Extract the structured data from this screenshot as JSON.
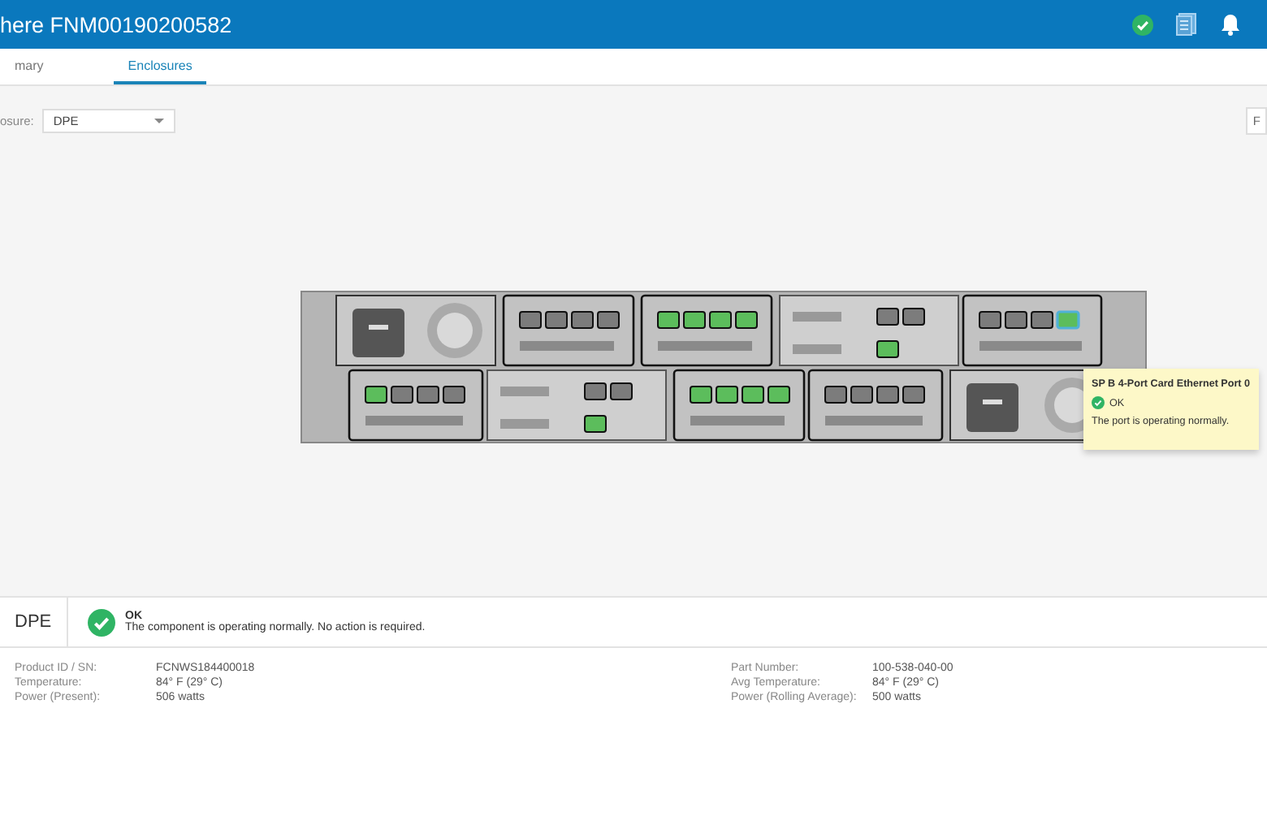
{
  "header": {
    "title": "here FNM00190200582"
  },
  "tabs": [
    {
      "label": "mary",
      "selected": false
    },
    {
      "label": "Enclosures",
      "selected": true
    }
  ],
  "enclosure_select": {
    "label": "osure:",
    "value": "DPE"
  },
  "side_button": {
    "label": "F"
  },
  "enclosure": {
    "rows": [
      {
        "modules": [
          {
            "kind": "psu"
          },
          {
            "kind": "card",
            "ports": [
              {
                "linked": false,
                "selected": false
              },
              {
                "linked": false,
                "selected": false
              },
              {
                "linked": false,
                "selected": false
              },
              {
                "linked": false,
                "selected": false
              }
            ]
          },
          {
            "kind": "card",
            "ports": [
              {
                "linked": true,
                "selected": false
              },
              {
                "linked": true,
                "selected": false
              },
              {
                "linked": true,
                "selected": false
              },
              {
                "linked": true,
                "selected": false
              }
            ]
          },
          {
            "kind": "mgmt",
            "ports": [
              {
                "linked": false,
                "selected": false
              },
              {
                "linked": false,
                "selected": false
              },
              {
                "linked": true,
                "selected": false
              }
            ]
          },
          {
            "kind": "card",
            "ports": [
              {
                "linked": false,
                "selected": false
              },
              {
                "linked": false,
                "selected": false
              },
              {
                "linked": false,
                "selected": false
              },
              {
                "linked": true,
                "selected": true
              }
            ]
          }
        ]
      },
      {
        "modules": [
          {
            "kind": "card",
            "ports": [
              {
                "linked": true,
                "selected": false
              },
              {
                "linked": false,
                "selected": false
              },
              {
                "linked": false,
                "selected": false
              },
              {
                "linked": false,
                "selected": false
              }
            ]
          },
          {
            "kind": "mgmt",
            "ports": [
              {
                "linked": false,
                "selected": false
              },
              {
                "linked": false,
                "selected": false
              },
              {
                "linked": true,
                "selected": false
              }
            ]
          },
          {
            "kind": "card",
            "ports": [
              {
                "linked": true,
                "selected": false
              },
              {
                "linked": true,
                "selected": false
              },
              {
                "linked": true,
                "selected": false
              },
              {
                "linked": true,
                "selected": false
              }
            ]
          },
          {
            "kind": "card",
            "ports": [
              {
                "linked": false,
                "selected": false
              },
              {
                "linked": false,
                "selected": false
              },
              {
                "linked": false,
                "selected": false
              },
              {
                "linked": false,
                "selected": false
              }
            ]
          },
          {
            "kind": "psu"
          }
        ]
      }
    ]
  },
  "tooltip": {
    "title": "SP B 4-Port Card Ethernet Port 0",
    "status": "OK",
    "message": "The port is operating normally."
  },
  "summary": {
    "name": "DPE",
    "status": "OK",
    "message": "The component is operating normally. No action is required."
  },
  "details_left": [
    {
      "label": "Product ID / SN:",
      "value": "FCNWS184400018"
    },
    {
      "label": "Temperature:",
      "value": "84° F (29° C)"
    },
    {
      "label": "Power (Present):",
      "value": "506 watts"
    }
  ],
  "details_right": [
    {
      "label": "Part Number:",
      "value": "100-538-040-00"
    },
    {
      "label": "Avg Temperature:",
      "value": "84° F (29° C)"
    },
    {
      "label": "Power (Rolling Average):",
      "value": "500 watts"
    }
  ]
}
